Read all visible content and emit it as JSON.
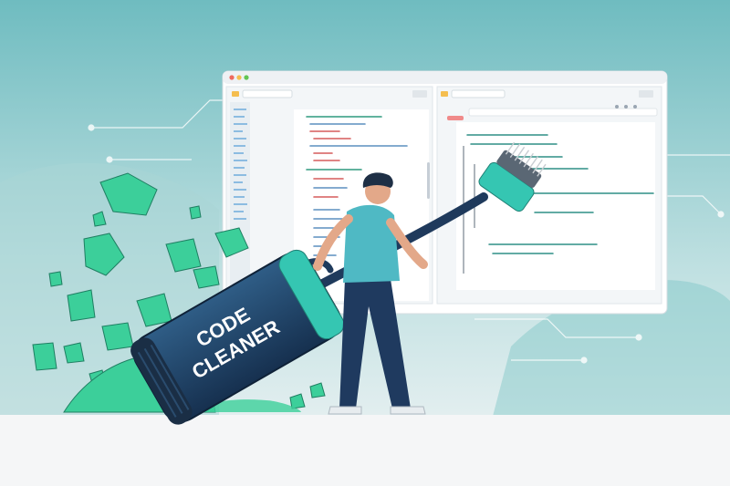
{
  "illustration": {
    "vacuum_label_line1": "CODE",
    "vacuum_label_line2": "CLEANER"
  },
  "colors": {
    "background_top": "#7fc3c6",
    "background_bottom": "#f3f5f6",
    "accent_teal": "#34c6b3",
    "dirt_green": "#3ccf9a",
    "navy": "#1e3a5f",
    "shirt": "#4fb9c4"
  },
  "window": {
    "traffic_lights": [
      "#ee6a5f",
      "#f5be4f",
      "#62c554"
    ]
  },
  "icons": [
    "folder-icon",
    "settings-icon",
    "window-controls-icon"
  ]
}
